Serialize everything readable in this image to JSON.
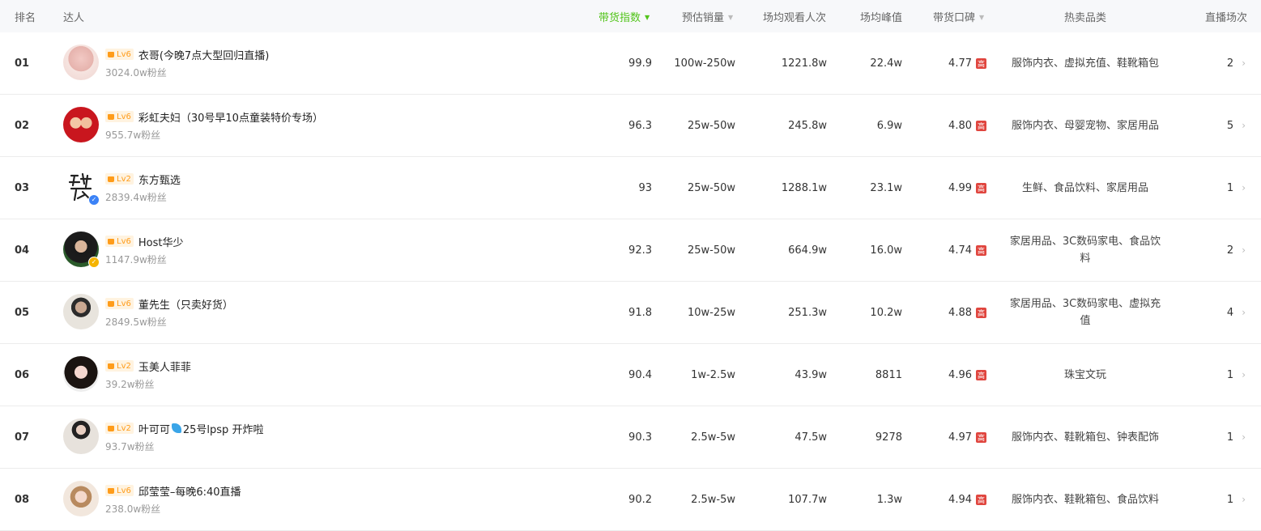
{
  "header": {
    "rank": "排名",
    "influencer": "达人",
    "sales_index": "带货指数",
    "est_sales": "预估销量",
    "avg_viewers": "场均观看人次",
    "avg_peak": "场均峰值",
    "reputation": "带货口碑",
    "hot_category": "热卖品类",
    "live_count": "直播场次"
  },
  "high_badge": "高",
  "rows": [
    {
      "rank": "01",
      "level": "Lv6",
      "name": "衣哥(今晚7点大型回归直播)",
      "fans": "3024.0w粉丝",
      "index": "99.9",
      "sales": "100w-250w",
      "viewers": "1221.8w",
      "peak": "22.4w",
      "score": "4.77",
      "category": "服饰内衣、虚拟充值、鞋靴箱包",
      "sessions": "2"
    },
    {
      "rank": "02",
      "level": "Lv6",
      "name": "彩虹夫妇（30号早10点童装特价专场）",
      "fans": "955.7w粉丝",
      "index": "96.3",
      "sales": "25w-50w",
      "viewers": "245.8w",
      "peak": "6.9w",
      "score": "4.80",
      "category": "服饰内衣、母婴宠物、家居用品",
      "sessions": "5"
    },
    {
      "rank": "03",
      "level": "Lv2",
      "name": "东方甄选",
      "fans": "2839.4w粉丝",
      "index": "93",
      "sales": "25w-50w",
      "viewers": "1288.1w",
      "peak": "23.1w",
      "score": "4.99",
      "category": "生鲜、食品饮料、家居用品",
      "sessions": "1"
    },
    {
      "rank": "04",
      "level": "Lv6",
      "name": "Host华少",
      "fans": "1147.9w粉丝",
      "index": "92.3",
      "sales": "25w-50w",
      "viewers": "664.9w",
      "peak": "16.0w",
      "score": "4.74",
      "category": "家居用品、3C数码家电、食品饮料",
      "sessions": "2"
    },
    {
      "rank": "05",
      "level": "Lv6",
      "name": "董先生（只卖好货）",
      "fans": "2849.5w粉丝",
      "index": "91.8",
      "sales": "10w-25w",
      "viewers": "251.3w",
      "peak": "10.2w",
      "score": "4.88",
      "category": "家居用品、3C数码家电、虚拟充值",
      "sessions": "4"
    },
    {
      "rank": "06",
      "level": "Lv2",
      "name": "玉美人菲菲",
      "fans": "39.2w粉丝",
      "index": "90.4",
      "sales": "1w-2.5w",
      "viewers": "43.9w",
      "peak": "8811",
      "score": "4.96",
      "category": "珠宝文玩",
      "sessions": "1"
    },
    {
      "rank": "07",
      "level": "Lv2",
      "name": "叶可可",
      "name_suffix": "25号lpsp 开炸啦",
      "fans": "93.7w粉丝",
      "index": "90.3",
      "sales": "2.5w-5w",
      "viewers": "47.5w",
      "peak": "9278",
      "score": "4.97",
      "category": "服饰内衣、鞋靴箱包、钟表配饰",
      "sessions": "1"
    },
    {
      "rank": "08",
      "level": "Lv6",
      "name": "邱莹莹–每晚6:40直播",
      "fans": "238.0w粉丝",
      "index": "90.2",
      "sales": "2.5w-5w",
      "viewers": "107.7w",
      "peak": "1.3w",
      "score": "4.94",
      "category": "服饰内衣、鞋靴箱包、食品饮料",
      "sessions": "1"
    }
  ],
  "colors": {
    "accent_green": "#52c41a",
    "level_orange": "#ff9c1a",
    "high_red": "#e0463f",
    "verify_blue": "#3b82f6",
    "verify_gold": "#f5b400"
  }
}
